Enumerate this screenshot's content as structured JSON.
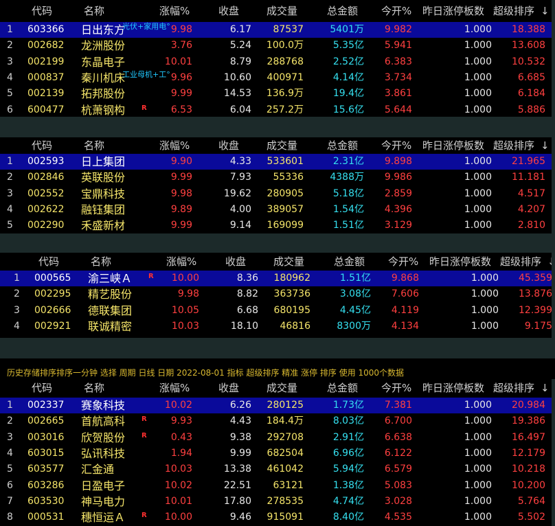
{
  "columns": {
    "code": "代码",
    "name": "名称",
    "change": "涨幅%",
    "close": "收盘",
    "volume": "成交量",
    "amount": "总金额",
    "open": "今开%",
    "limit": "昨日涨停板数",
    "rank": "超级排序",
    "sort_arrow": "↓"
  },
  "colors": {
    "up": "#ff4040",
    "down": "#35e0f0",
    "code": "#f5e56a",
    "selected_bg": "#0a0a9a"
  },
  "strip_text": "历史存储排序排序一分钟 选择 周期 日线 日期 2022-08-01 指标 超级排序 精准 涨停 排序 使用 1000个数据",
  "tables": [
    {
      "rows": [
        {
          "no": "1",
          "code": "603366",
          "name": "日出东方",
          "change": "9.98",
          "close": "6.17",
          "volume": "87537",
          "amount": "5401万",
          "open": "9.982",
          "limit": "1.000",
          "rank": "18.388",
          "tag": "光伏+家用电°",
          "badge": "",
          "selected": true
        },
        {
          "no": "2",
          "code": "002682",
          "name": "龙洲股份",
          "change": "3.76",
          "close": "5.24",
          "volume": "100.0万",
          "amount": "5.35亿",
          "open": "5.941",
          "limit": "1.000",
          "rank": "13.608",
          "tag": "",
          "badge": "",
          "selected": false
        },
        {
          "no": "3",
          "code": "002199",
          "name": "东晶电子",
          "change": "10.01",
          "close": "8.79",
          "volume": "288768",
          "amount": "2.52亿",
          "open": "6.383",
          "limit": "1.000",
          "rank": "10.532",
          "tag": "",
          "badge": "",
          "selected": false
        },
        {
          "no": "4",
          "code": "000837",
          "name": "秦川机床",
          "change": "9.96",
          "close": "10.60",
          "volume": "400971",
          "amount": "4.14亿",
          "open": "3.734",
          "limit": "1.000",
          "rank": "6.685",
          "tag": "工业母机+工°",
          "badge": "",
          "selected": false
        },
        {
          "no": "5",
          "code": "002139",
          "name": "拓邦股份",
          "change": "9.99",
          "close": "14.53",
          "volume": "136.9万",
          "amount": "19.4亿",
          "open": "3.861",
          "limit": "1.000",
          "rank": "6.184",
          "tag": "",
          "badge": "",
          "selected": false
        },
        {
          "no": "6",
          "code": "600477",
          "name": "杭萧钢构",
          "change": "6.53",
          "close": "6.04",
          "volume": "257.2万",
          "amount": "15.6亿",
          "open": "5.644",
          "limit": "1.000",
          "rank": "5.886",
          "tag": "",
          "badge": "R",
          "selected": false
        }
      ]
    },
    {
      "rows": [
        {
          "no": "1",
          "code": "002593",
          "name": "日上集团",
          "change": "9.90",
          "close": "4.33",
          "volume": "533601",
          "amount": "2.31亿",
          "open": "9.898",
          "limit": "1.000",
          "rank": "21.965",
          "tag": "",
          "badge": "",
          "selected": true
        },
        {
          "no": "2",
          "code": "002846",
          "name": "英联股份",
          "change": "9.99",
          "close": "7.93",
          "volume": "55336",
          "amount": "4388万",
          "open": "9.986",
          "limit": "1.000",
          "rank": "11.181",
          "tag": "",
          "badge": "",
          "selected": false
        },
        {
          "no": "3",
          "code": "002552",
          "name": "宝鼎科技",
          "change": "9.98",
          "close": "19.62",
          "volume": "280905",
          "amount": "5.18亿",
          "open": "2.859",
          "limit": "1.000",
          "rank": "4.517",
          "tag": "",
          "badge": "",
          "selected": false
        },
        {
          "no": "4",
          "code": "002622",
          "name": "融钰集团",
          "change": "9.89",
          "close": "4.00",
          "volume": "389057",
          "amount": "1.54亿",
          "open": "4.396",
          "limit": "1.000",
          "rank": "4.207",
          "tag": "",
          "badge": "",
          "selected": false
        },
        {
          "no": "5",
          "code": "002290",
          "name": "禾盛新材",
          "change": "9.99",
          "close": "9.14",
          "volume": "169099",
          "amount": "1.51亿",
          "open": "3.129",
          "limit": "1.000",
          "rank": "2.810",
          "tag": "",
          "badge": "",
          "selected": false
        }
      ]
    },
    {
      "rows": [
        {
          "no": "1",
          "code": "000565",
          "name": "渝三峡Ａ",
          "change": "10.00",
          "close": "8.36",
          "volume": "180962",
          "amount": "1.51亿",
          "open": "9.868",
          "limit": "1.000",
          "rank": "45.359",
          "tag": "",
          "badge": "R",
          "selected": true
        },
        {
          "no": "2",
          "code": "002295",
          "name": "精艺股份",
          "change": "9.98",
          "close": "8.82",
          "volume": "363736",
          "amount": "3.08亿",
          "open": "7.606",
          "limit": "1.000",
          "rank": "13.876",
          "tag": "",
          "badge": "",
          "selected": false
        },
        {
          "no": "3",
          "code": "002666",
          "name": "德联集团",
          "change": "10.05",
          "close": "6.68",
          "volume": "680195",
          "amount": "4.45亿",
          "open": "4.119",
          "limit": "1.000",
          "rank": "12.399",
          "tag": "",
          "badge": "",
          "selected": false
        },
        {
          "no": "4",
          "code": "002921",
          "name": "联诚精密",
          "change": "10.03",
          "close": "18.10",
          "volume": "46816",
          "amount": "8300万",
          "open": "4.134",
          "limit": "1.000",
          "rank": "9.175",
          "tag": "",
          "badge": "",
          "selected": false
        }
      ]
    },
    {
      "rows": [
        {
          "no": "1",
          "code": "002337",
          "name": "赛象科技",
          "change": "10.02",
          "close": "6.26",
          "volume": "280125",
          "amount": "1.73亿",
          "open": "7.381",
          "limit": "1.000",
          "rank": "20.984",
          "tag": "",
          "badge": "",
          "selected": true
        },
        {
          "no": "2",
          "code": "002665",
          "name": "首航高科",
          "change": "9.93",
          "close": "4.43",
          "volume": "184.4万",
          "amount": "8.03亿",
          "open": "6.700",
          "limit": "1.000",
          "rank": "19.386",
          "tag": "",
          "badge": "R",
          "selected": false
        },
        {
          "no": "3",
          "code": "003016",
          "name": "欣贺股份",
          "change": "0.43",
          "close": "9.38",
          "volume": "292708",
          "amount": "2.91亿",
          "open": "6.638",
          "limit": "1.000",
          "rank": "16.497",
          "tag": "",
          "badge": "R",
          "selected": false
        },
        {
          "no": "4",
          "code": "603015",
          "name": "弘讯科技",
          "change": "1.94",
          "close": "9.99",
          "volume": "682504",
          "amount": "6.96亿",
          "open": "6.122",
          "limit": "1.000",
          "rank": "12.179",
          "tag": "",
          "badge": "",
          "selected": false
        },
        {
          "no": "5",
          "code": "603577",
          "name": "汇金通",
          "change": "10.03",
          "close": "13.38",
          "volume": "461042",
          "amount": "5.94亿",
          "open": "6.579",
          "limit": "1.000",
          "rank": "10.218",
          "tag": "",
          "badge": "",
          "selected": false
        },
        {
          "no": "6",
          "code": "603286",
          "name": "日盈电子",
          "change": "10.02",
          "close": "22.51",
          "volume": "63121",
          "amount": "1.38亿",
          "open": "5.083",
          "limit": "1.000",
          "rank": "10.200",
          "tag": "",
          "badge": "",
          "selected": false
        },
        {
          "no": "7",
          "code": "603530",
          "name": "神马电力",
          "change": "10.01",
          "close": "17.80",
          "volume": "278535",
          "amount": "4.74亿",
          "open": "3.028",
          "limit": "1.000",
          "rank": "5.764",
          "tag": "",
          "badge": "",
          "selected": false
        },
        {
          "no": "8",
          "code": "000531",
          "name": "穗恒运Ａ",
          "change": "10.00",
          "close": "9.46",
          "volume": "915091",
          "amount": "8.40亿",
          "open": "4.535",
          "limit": "1.000",
          "rank": "5.502",
          "tag": "",
          "badge": "R",
          "selected": false
        }
      ]
    }
  ]
}
